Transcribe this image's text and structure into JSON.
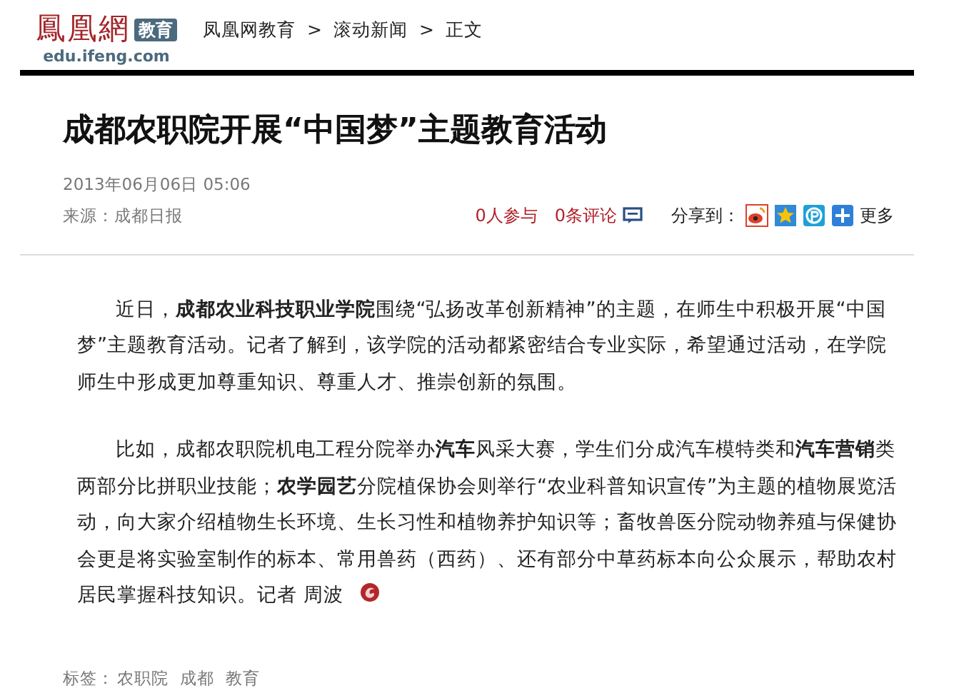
{
  "logo": {
    "name": "鳳凰網",
    "channel": "教育",
    "domain": "edu.ifeng.com"
  },
  "breadcrumb": [
    "凤凰网教育",
    "滚动新闻",
    "正文"
  ],
  "breadcrumb_separator": ">",
  "article": {
    "title": "成都农职院开展“中国梦”主题教育活动",
    "date": "2013年06月06日  05:06",
    "source": "来源：成都日报",
    "participants": "0人参与",
    "comments": "0条评论",
    "share_label": "分享到：",
    "share_more": "更多",
    "paragraphs": [
      [
        {
          "kind": "text",
          "text": "近日，"
        },
        {
          "kind": "link",
          "text": "成都农业科技职业学院"
        },
        {
          "kind": "text",
          "text": "围绕“弘扬改革创新精神”的主题，在师生中积极开展“中国梦”主题教育活动。记者了解到，该学院的活动都紧密结合专业实际，希望通过活动，在学院师生中形成更加尊重知识、尊重人才、推崇创新的氛围。"
        }
      ],
      [
        {
          "kind": "text",
          "text": "比如，成都农职院机电工程分院举办"
        },
        {
          "kind": "link",
          "text": "汽车"
        },
        {
          "kind": "text",
          "text": "风采大赛，学生们分成汽车模特类和"
        },
        {
          "kind": "link",
          "text": "汽车营销"
        },
        {
          "kind": "text",
          "text": "类两部分比拼职业技能；"
        },
        {
          "kind": "link",
          "text": "农学园艺"
        },
        {
          "kind": "text",
          "text": "分院植保协会则举行“农业科普知识宣传”为主题的植物展览活动，向大家介绍植物生长环境、生长习性和植物养护知识等；畜牧兽医分院动物养殖与保健协会更是将实验室制作的标本、常用兽药（西药）、还有部分中草药标本向公众展示，帮助农村居民掌握科技知识。记者  周波"
        }
      ]
    ],
    "tags_label": "标签：",
    "tags": [
      "农职院",
      "成都",
      "教育"
    ]
  }
}
